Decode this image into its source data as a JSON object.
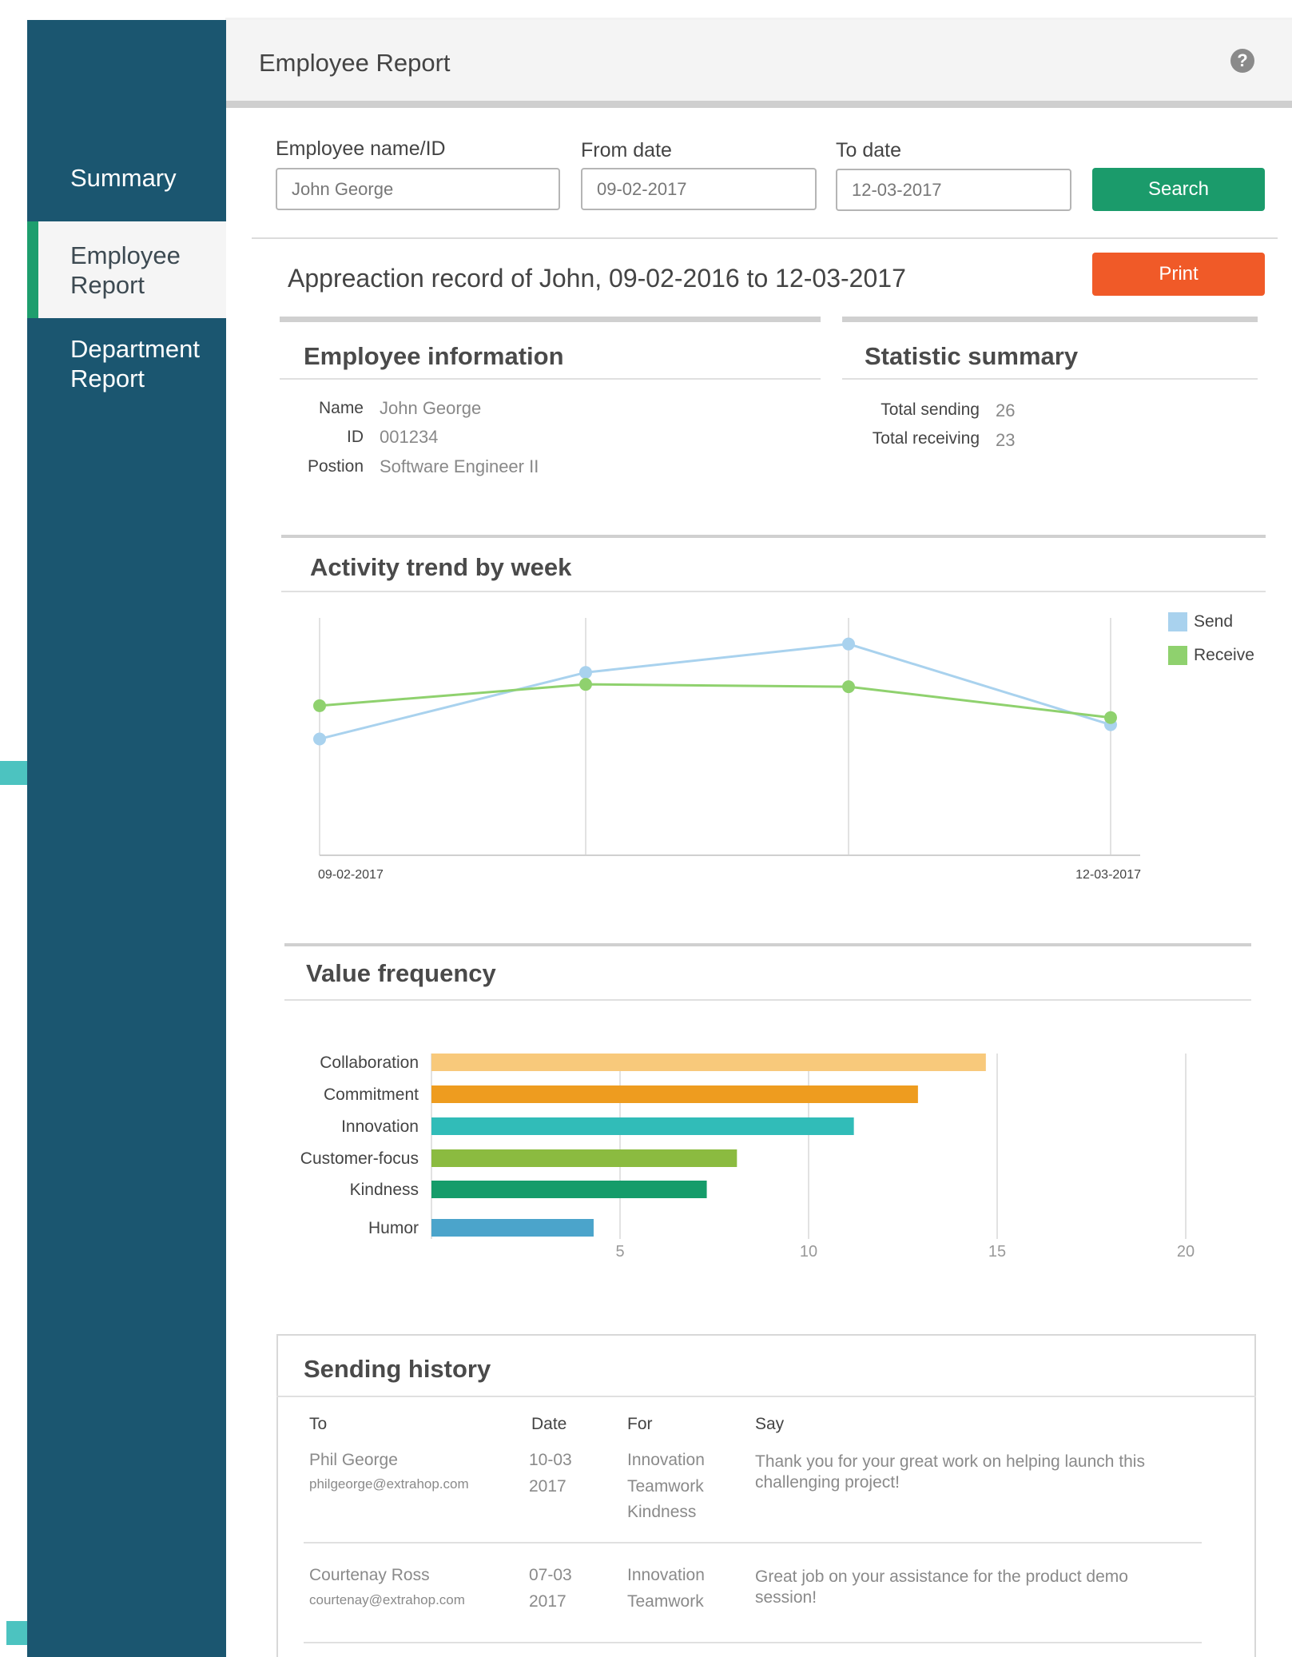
{
  "sidebar": {
    "items": [
      {
        "label": "Summary",
        "active": false
      },
      {
        "label": "Employee Report",
        "active": true
      },
      {
        "label": "Department Report",
        "active": false
      }
    ]
  },
  "header": {
    "title": "Employee Report",
    "help_icon": "question-circle-icon"
  },
  "search_form": {
    "employee_label": "Employee name/ID",
    "employee_value": "John George",
    "from_label": "From date",
    "from_value": "09-02-2017",
    "to_label": "To date",
    "to_value": "12-03-2017",
    "search_label": "Search"
  },
  "record": {
    "title": "Appreaction record of John, 09-02-2016 to 12-03-2017",
    "print_label": "Print"
  },
  "employee_info": {
    "title": "Employee information",
    "fields": [
      {
        "key": "Name",
        "value": "John George"
      },
      {
        "key": "ID",
        "value": "001234"
      },
      {
        "key": "Postion",
        "value": "Software Engineer II"
      }
    ]
  },
  "statistic_summary": {
    "title": "Statistic summary",
    "fields": [
      {
        "key": "Total sending",
        "value": "26"
      },
      {
        "key": "Total receiving",
        "value": "23"
      }
    ]
  },
  "colors": {
    "send": "#a9d2ee",
    "receive": "#8fd16e",
    "sidebar": "#1b5670",
    "search": "#1b9b6b",
    "print": "#f05a28"
  },
  "chart_data": [
    {
      "type": "line",
      "title": "Activity trend by week",
      "x_tick_labels": [
        "09-02-2017",
        "",
        "",
        "12-03-2017"
      ],
      "legend_position": "top-right",
      "series": [
        {
          "name": "Send",
          "values": [
            4.9,
            7.7,
            8.9,
            5.5
          ]
        },
        {
          "name": "Receive",
          "values": [
            6.3,
            7.2,
            7.1,
            5.8
          ]
        }
      ],
      "ylim": [
        0,
        10
      ],
      "grid": "vertical"
    },
    {
      "type": "bar",
      "orientation": "horizontal",
      "title": "Value frequency",
      "categories": [
        "Collaboration",
        "Commitment",
        "Innovation",
        "Customer-focus",
        "Kindness",
        "Humor"
      ],
      "values": [
        14.7,
        12.9,
        11.2,
        8.1,
        7.3,
        4.3
      ],
      "bar_colors": [
        "#f8c97b",
        "#ee9c1f",
        "#31bcb8",
        "#8bbb40",
        "#159c6a",
        "#4ba4cb"
      ],
      "xticks": [
        5,
        10,
        15,
        20
      ],
      "xlim": [
        0,
        20
      ],
      "grid": "vertical"
    }
  ],
  "sending_history": {
    "title": "Sending history",
    "headers": {
      "to": "To",
      "date": "Date",
      "for": "For",
      "say": "Say"
    },
    "rows": [
      {
        "name": "Phil George",
        "email": "philgeorge@extrahop.com",
        "date_day": "10-03",
        "date_year": "2017",
        "values": [
          "Innovation",
          "Teamwork",
          "Kindness"
        ],
        "say": "Thank you for your great work on helping launch this challenging project!"
      },
      {
        "name": "Courtenay Ross",
        "email": "courtenay@extrahop.com",
        "date_day": "07-03",
        "date_year": "2017",
        "values": [
          "Innovation",
          "Teamwork"
        ],
        "say": "Great job on your assistance for the product demo session!"
      }
    ]
  }
}
